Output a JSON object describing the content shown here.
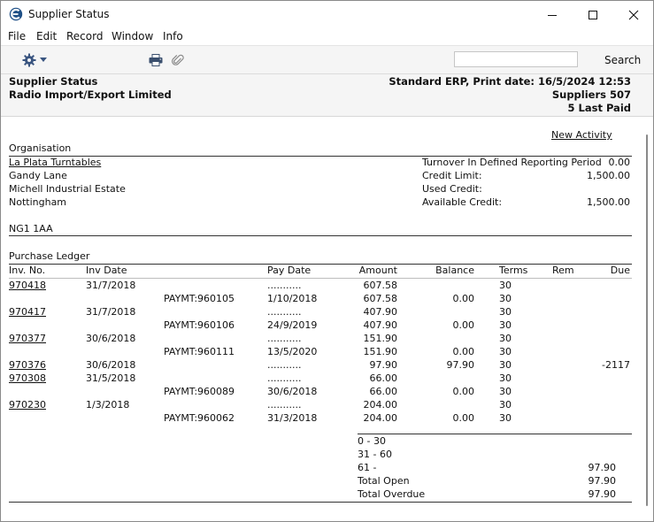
{
  "window": {
    "title": "Supplier Status"
  },
  "menu": [
    "File",
    "Edit",
    "Record",
    "Window",
    "Info"
  ],
  "toolbar": {
    "search_value": "",
    "search_label": "Search"
  },
  "header": {
    "report_name": "Supplier Status",
    "company": "Radio Import/Export Limited",
    "print_info": "Standard ERP, Print date: 16/5/2024 12:53",
    "suppliers": "Suppliers 507",
    "last_paid": "5 Last Paid"
  },
  "body": {
    "new_activity": "New Activity",
    "organisation_label": "Organisation",
    "supplier_name": "La Plata Turntables",
    "address": [
      "Gandy Lane",
      "Michell Industrial Estate",
      "Nottingham"
    ],
    "postcode": "NG1 1AA",
    "credit": {
      "turnover_label": "Turnover In Defined Reporting Period",
      "turnover_value": "0.00",
      "credit_limit_label": "Credit Limit:",
      "credit_limit_value": "1,500.00",
      "used_credit_label": "Used Credit:",
      "used_credit_value": "",
      "available_credit_label": "Available Credit:",
      "available_credit_value": "1,500.00"
    },
    "ledger_label": "Purchase Ledger",
    "columns": {
      "inv_no": "Inv. No.",
      "inv_date": "Inv Date",
      "pay_date": "Pay Date",
      "amount": "Amount",
      "balance": "Balance",
      "terms": "Terms",
      "rem": "Rem",
      "due": "Due"
    },
    "rows": [
      {
        "inv_no": "970418",
        "inv_date": "31/7/2018",
        "payment": "",
        "pay_date": "...........",
        "amount": "607.58",
        "balance": "",
        "terms": "30",
        "due": ""
      },
      {
        "inv_no": "",
        "inv_date": "",
        "payment": "PAYMT:960105",
        "pay_date": "1/10/2018",
        "amount": "607.58",
        "balance": "0.00",
        "terms": "30",
        "due": ""
      },
      {
        "inv_no": "970417",
        "inv_date": "31/7/2018",
        "payment": "",
        "pay_date": "...........",
        "amount": "407.90",
        "balance": "",
        "terms": "30",
        "due": ""
      },
      {
        "inv_no": "",
        "inv_date": "",
        "payment": "PAYMT:960106",
        "pay_date": "24/9/2019",
        "amount": "407.90",
        "balance": "0.00",
        "terms": "30",
        "due": ""
      },
      {
        "inv_no": "970377",
        "inv_date": "30/6/2018",
        "payment": "",
        "pay_date": "...........",
        "amount": "151.90",
        "balance": "",
        "terms": "30",
        "due": ""
      },
      {
        "inv_no": "",
        "inv_date": "",
        "payment": "PAYMT:960111",
        "pay_date": "13/5/2020",
        "amount": "151.90",
        "balance": "0.00",
        "terms": "30",
        "due": ""
      },
      {
        "inv_no": "970376",
        "inv_date": "30/6/2018",
        "payment": "",
        "pay_date": "...........",
        "amount": "97.90",
        "balance": "97.90",
        "terms": "30",
        "due": "-2117"
      },
      {
        "inv_no": "970308",
        "inv_date": "31/5/2018",
        "payment": "",
        "pay_date": "...........",
        "amount": "66.00",
        "balance": "",
        "terms": "30",
        "due": ""
      },
      {
        "inv_no": "",
        "inv_date": "",
        "payment": "PAYMT:960089",
        "pay_date": "30/6/2018",
        "amount": "66.00",
        "balance": "0.00",
        "terms": "30",
        "due": ""
      },
      {
        "inv_no": "970230",
        "inv_date": "1/3/2018",
        "payment": "",
        "pay_date": "...........",
        "amount": "204.00",
        "balance": "",
        "terms": "30",
        "due": ""
      },
      {
        "inv_no": "",
        "inv_date": "",
        "payment": "PAYMT:960062",
        "pay_date": "31/3/2018",
        "amount": "204.00",
        "balance": "0.00",
        "terms": "30",
        "due": ""
      }
    ],
    "summary": [
      {
        "label": "0 - 30",
        "value": ""
      },
      {
        "label": "31 - 60",
        "value": ""
      },
      {
        "label": "61 -",
        "value": "97.90"
      },
      {
        "label": "Total Open",
        "value": "97.90"
      },
      {
        "label": "Total Overdue",
        "value": "97.90"
      }
    ]
  }
}
